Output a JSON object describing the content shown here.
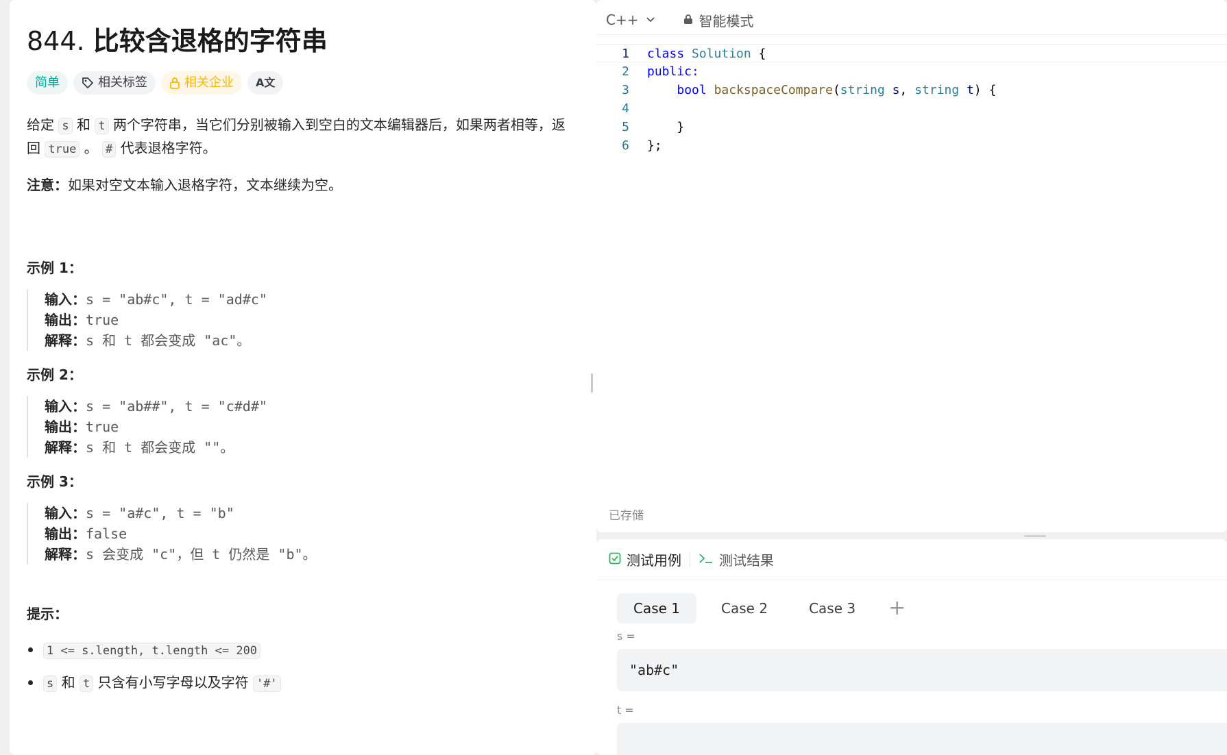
{
  "problem": {
    "number": "844.",
    "title": "比较含退格的字符串",
    "tags": {
      "difficulty": "简单",
      "related_tags": "相关标签",
      "related_companies": "相关企业",
      "translate": "A文"
    },
    "description": {
      "p1_a": "给定",
      "p1_s": "s",
      "p1_and": "和",
      "p1_t": "t",
      "p1_b": "两个字符串，当它们分别被输入到空白的文本编辑器后，如果两者相等，返回",
      "p1_true": "true",
      "p1_c": "。",
      "p1_hash": "#",
      "p1_d": "代表退格字符。",
      "note_label": "注意：",
      "note_text": "如果对空文本输入退格字符，文本继续为空。"
    },
    "examples": [
      {
        "title": "示例 1：",
        "input_label": "输入：",
        "input": "s = \"ab#c\", t = \"ad#c\"",
        "output_label": "输出：",
        "output": "true",
        "explain_label": "解释：",
        "explain": "s 和 t 都会变成 \"ac\"。"
      },
      {
        "title": "示例 2：",
        "input_label": "输入：",
        "input": "s = \"ab##\", t = \"c#d#\"",
        "output_label": "输出：",
        "output": "true",
        "explain_label": "解释：",
        "explain": "s 和 t 都会变成 \"\"。"
      },
      {
        "title": "示例 3：",
        "input_label": "输入：",
        "input": "s = \"a#c\", t = \"b\"",
        "output_label": "输出：",
        "output": "false",
        "explain_label": "解释：",
        "explain": "s 会变成 \"c\"，但 t 仍然是 \"b\"。"
      }
    ],
    "tips": {
      "title": "提示：",
      "tip1_code": "1 <= s.length, t.length <= 200",
      "tip2_s": "s",
      "tip2_and": "和",
      "tip2_t": "t",
      "tip2_text": "只含有小写字母以及字符",
      "tip2_code": "'#'"
    }
  },
  "editor": {
    "language": "C++",
    "mode": "智能模式",
    "saved_status": "已存储",
    "line_numbers": [
      "1",
      "2",
      "3",
      "4",
      "5",
      "6"
    ],
    "code": {
      "l1_kw": "class",
      "l1_name": "Solution",
      "l1_rest": " {",
      "l2": "public:",
      "l3_type": "bool",
      "l3_fn": "backspaceCompare",
      "l3_p1_type": "string",
      "l3_p1": "s",
      "l3_p2_type": "string",
      "l3_p2": "t",
      "l5": "}",
      "l6": "};"
    }
  },
  "tests": {
    "tab_cases": "测试用例",
    "tab_result": "测试结果",
    "cases": [
      "Case 1",
      "Case 2",
      "Case 3"
    ],
    "add": "+",
    "var_s_label": "s =",
    "var_s_value": "\"ab#c\"",
    "var_t_label": "t ="
  },
  "colors": {
    "easy": "#00af9b",
    "company": "#ffb700",
    "check_green": "#2db55d"
  }
}
